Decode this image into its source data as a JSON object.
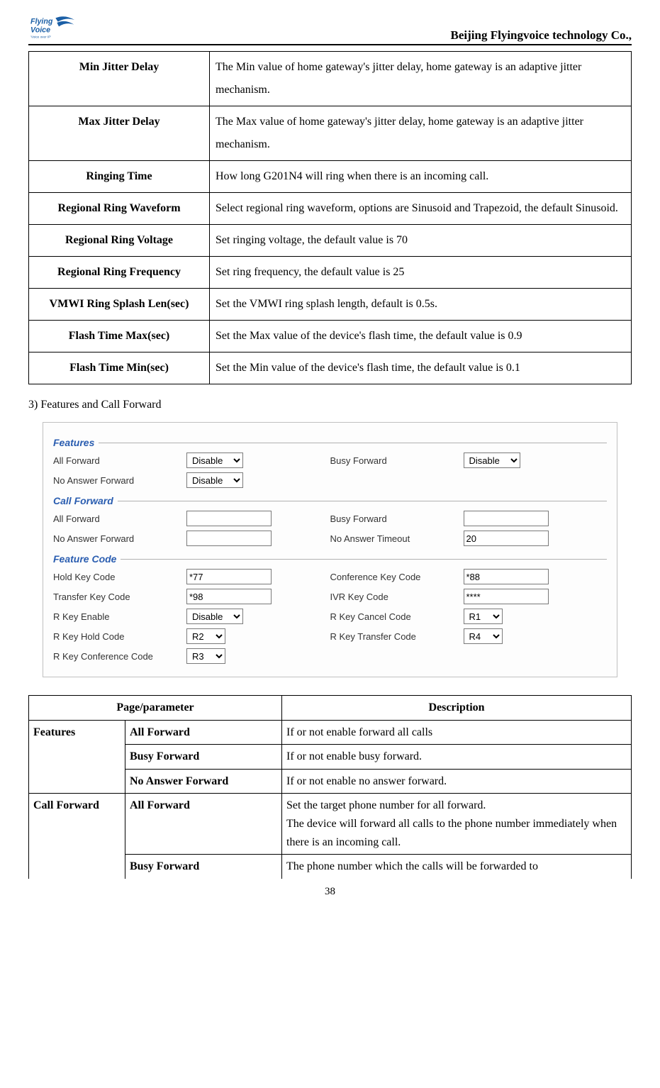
{
  "header": {
    "company": "Beijing Flyingvoice technology Co.,",
    "logo_text_top": "Flying",
    "logo_text_bottom": "Voice",
    "logo_tag": "'Voice over IP'"
  },
  "table1": [
    {
      "label": "Min Jitter Delay",
      "desc": "The Min value of home gateway's jitter delay, home gateway is an adaptive jitter mechanism."
    },
    {
      "label": "Max Jitter Delay",
      "desc": "The Max value of home gateway's jitter delay, home gateway is an adaptive jitter mechanism."
    },
    {
      "label": "Ringing Time",
      "desc": "How long G201N4 will ring when there is an incoming call."
    },
    {
      "label": "Regional Ring Waveform",
      "desc": "Select regional ring waveform, options are Sinusoid and Trapezoid, the default Sinusoid."
    },
    {
      "label": "Regional Ring Voltage",
      "desc": "Set ringing voltage, the default value is 70"
    },
    {
      "label": "Regional Ring Frequency",
      "desc": "Set ring frequency, the default value is 25"
    },
    {
      "label": "VMWI Ring Splash Len(sec)",
      "desc": "Set the VMWI ring splash length, default is 0.5s."
    },
    {
      "label": "Flash Time Max(sec)",
      "desc": "Set the Max value of the device's flash time, the default value is 0.9"
    },
    {
      "label": "Flash Time Min(sec)",
      "desc": "Set the Min value of the device's flash time, the default value is 0.1"
    }
  ],
  "section_title": "3) Features and Call Forward",
  "ui": {
    "features": {
      "title": "Features",
      "all_forward_label": "All Forward",
      "all_forward_value": "Disable",
      "busy_forward_label": "Busy Forward",
      "busy_forward_value": "Disable",
      "no_answer_forward_label": "No Answer Forward",
      "no_answer_forward_value": "Disable"
    },
    "call_forward": {
      "title": "Call Forward",
      "all_forward_label": "All Forward",
      "all_forward_value": "",
      "busy_forward_label": "Busy Forward",
      "busy_forward_value": "",
      "no_answer_forward_label": "No Answer Forward",
      "no_answer_forward_value": "",
      "no_answer_timeout_label": "No Answer Timeout",
      "no_answer_timeout_value": "20"
    },
    "feature_code": {
      "title": "Feature Code",
      "hold_key_code_label": "Hold Key Code",
      "hold_key_code_value": "*77",
      "conference_key_code_label": "Conference Key Code",
      "conference_key_code_value": "*88",
      "transfer_key_code_label": "Transfer Key Code",
      "transfer_key_code_value": "*98",
      "ivr_key_code_label": "IVR Key Code",
      "ivr_key_code_value": "****",
      "r_key_enable_label": "R Key Enable",
      "r_key_enable_value": "Disable",
      "r_key_cancel_code_label": "R Key Cancel Code",
      "r_key_cancel_code_value": "R1",
      "r_key_hold_code_label": "R Key Hold Code",
      "r_key_hold_code_value": "R2",
      "r_key_transfer_code_label": "R Key Transfer Code",
      "r_key_transfer_code_value": "R4",
      "r_key_conference_code_label": "R Key Conference Code",
      "r_key_conference_code_value": "R3"
    }
  },
  "desc_table": {
    "headers": [
      "Page/parameter",
      "Description"
    ],
    "features_group": "Features",
    "callforward_group": "Call Forward",
    "rows": {
      "f1": {
        "label": "All Forward",
        "desc": "If or not enable forward all calls"
      },
      "f2": {
        "label": "Busy Forward",
        "desc": "If or not enable busy forward."
      },
      "f3": {
        "label": "No Answer Forward",
        "desc": "If or not enable no answer forward."
      },
      "c1": {
        "label": "All Forward",
        "desc": "Set the target phone number for all forward.\nThe device will forward all calls to the phone number immediately when there is an incoming call."
      },
      "c2": {
        "label": "Busy Forward",
        "desc": "The phone number which the calls will be forwarded to"
      }
    }
  },
  "page_no": "38"
}
